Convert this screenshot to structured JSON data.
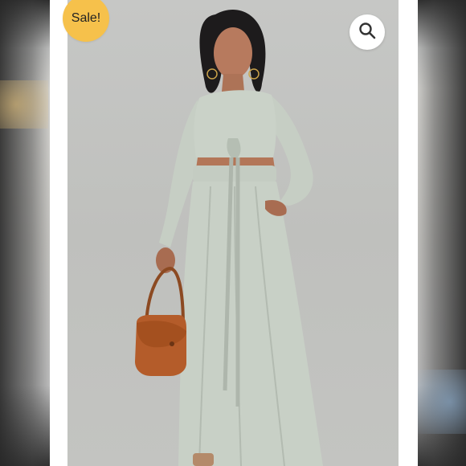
{
  "product_image": {
    "badge_label": "Sale!",
    "zoom_icon": "search-icon",
    "colors": {
      "badge": "#f6c14b",
      "outfit": "#c8d0c6",
      "handbag": "#b45c2a",
      "photo_background": "#c3c4c1"
    }
  }
}
